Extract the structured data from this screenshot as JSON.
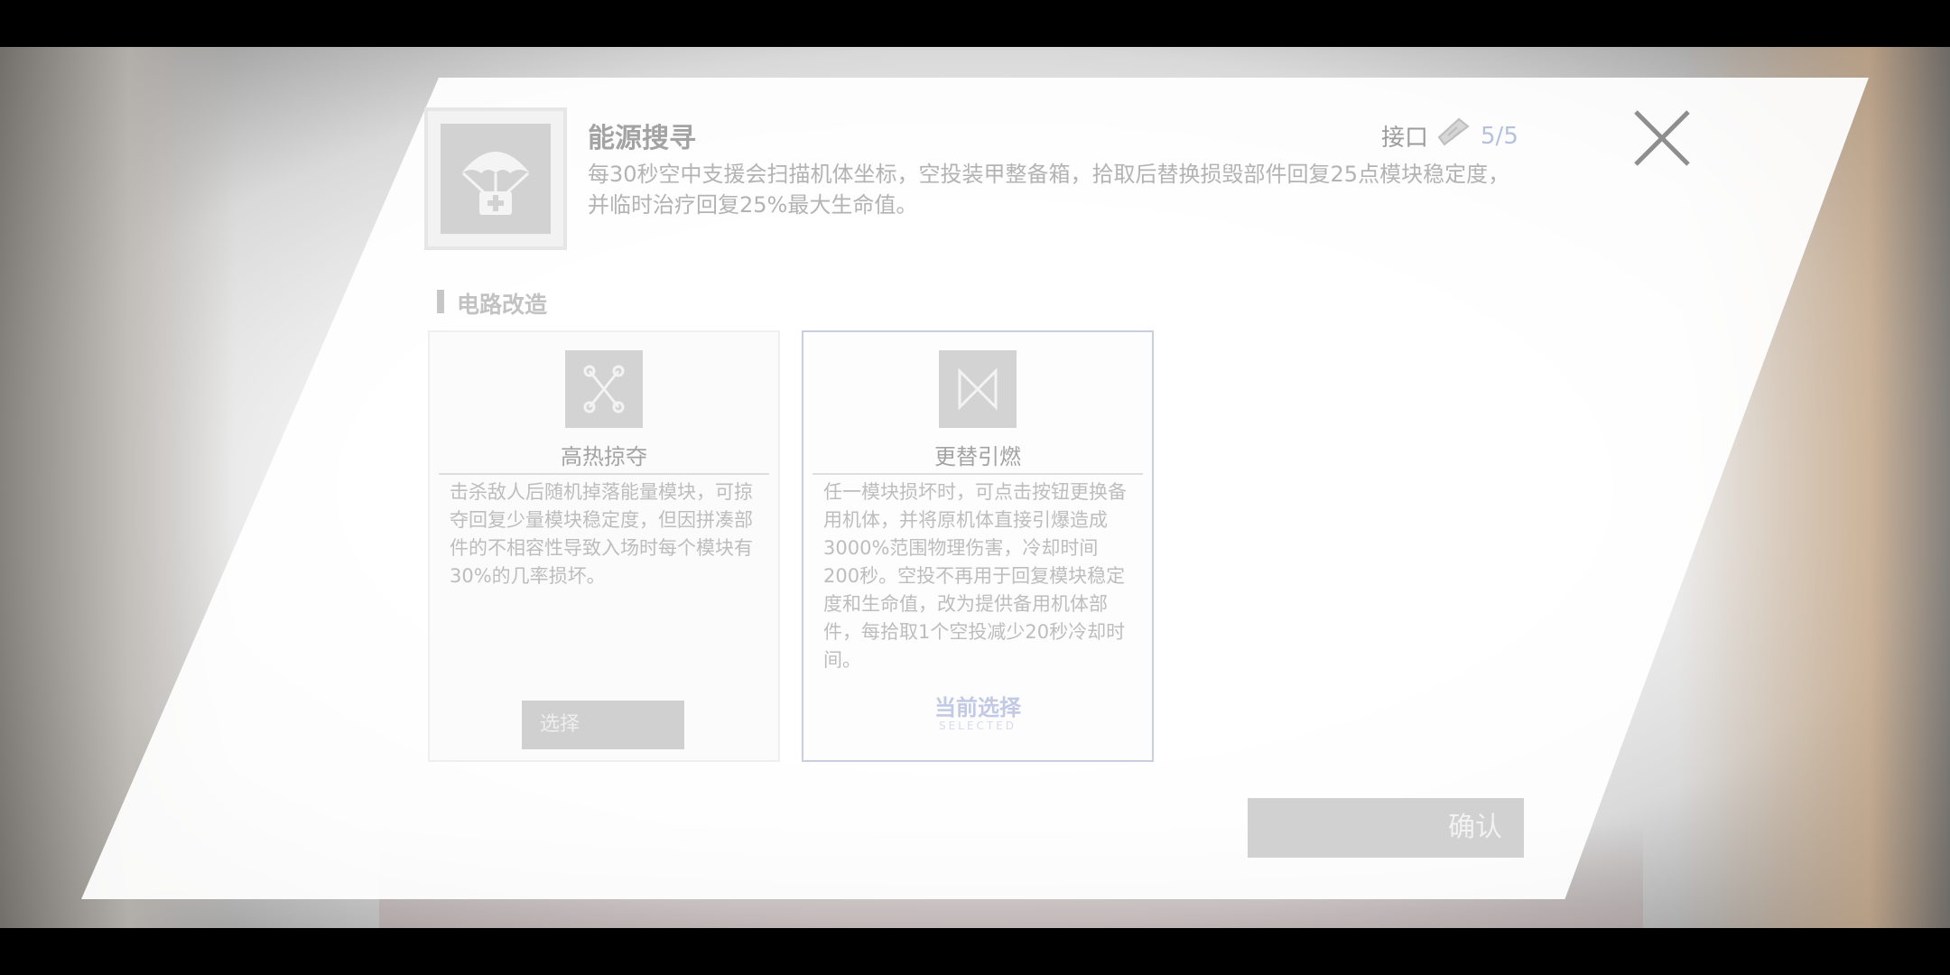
{
  "ability": {
    "icon": "parachute-supply-icon",
    "title": "能源搜寻",
    "description": "每30秒空中支援会扫描机体坐标，空投装甲整备箱，拾取后替换损毁部件回复25点模块稳定度，并临时治疗回复25%最大生命值。"
  },
  "slot": {
    "label": "接口",
    "icon": "chip-icon",
    "count": "5/5"
  },
  "close": {
    "icon": "close-icon"
  },
  "section": {
    "title": "电路改造"
  },
  "cards": [
    {
      "icon": "crossed-links-icon",
      "name": "高热掠夺",
      "description": "击杀敌人后随机掉落能量模块，可掠夺回复少量模块稳定度，但因拼凑部件的不相容性导致入场时每个模块有30%的几率损坏。",
      "button_label": "选择"
    },
    {
      "icon": "bowtie-swap-icon",
      "name": "更替引燃",
      "description": "任一模块损坏时，可点击按钮更换备用机体，并将原机体直接引爆造成3000%范围物理伤害，冷却时间200秒。空投不再用于回复模块稳定度和生命值，改为提供备用机体部件，每拾取1个空投减少20秒冷却时间。",
      "current_label": "当前选择",
      "current_sub": "SELECTED"
    }
  ],
  "confirm": {
    "label": "确认"
  }
}
